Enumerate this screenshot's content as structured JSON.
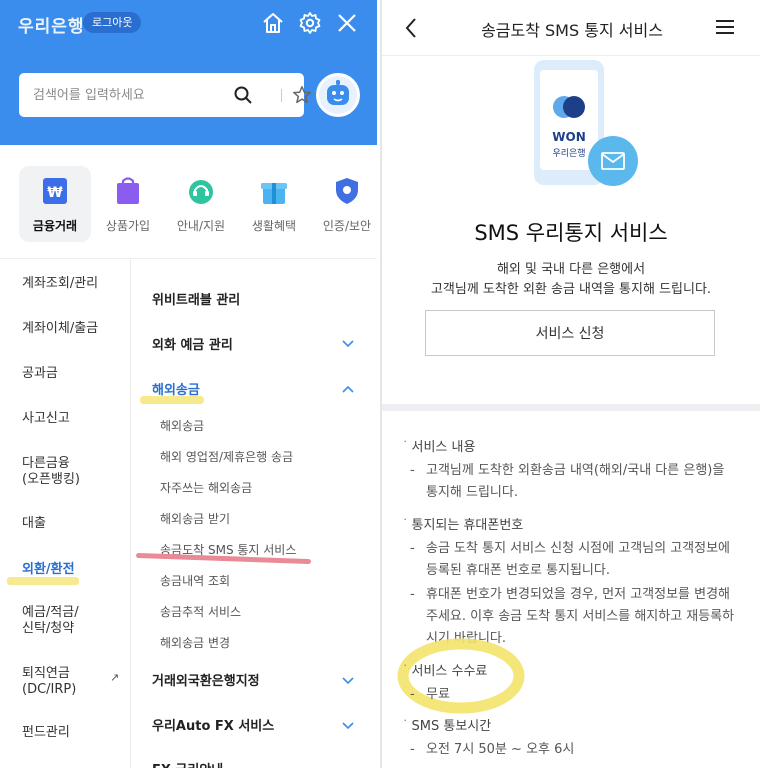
{
  "left": {
    "logo": "우리은행",
    "logout_label": "로그아웃",
    "search_placeholder": "검색어를 입력하세요",
    "categories": [
      {
        "label": "금융거래",
        "icon": "won-card-icon",
        "active": true
      },
      {
        "label": "상품가입",
        "icon": "shopping-bag-icon"
      },
      {
        "label": "안내/지원",
        "icon": "headset-icon"
      },
      {
        "label": "생활혜택",
        "icon": "gift-icon"
      },
      {
        "label": "인증/보안",
        "icon": "shield-icon"
      }
    ],
    "sidebar": [
      {
        "label": "계좌조회/관리"
      },
      {
        "label": "계좌이체/출금"
      },
      {
        "label": "공과금"
      },
      {
        "label": "사고신고"
      },
      {
        "label": "다른금융\n(오픈뱅킹)"
      },
      {
        "label": "대출"
      },
      {
        "label": "외환/환전",
        "active": true
      },
      {
        "label": "예금/적금/\n신탁/청약"
      },
      {
        "label": "퇴직연금\n(DC/IRP)",
        "external": "↗"
      },
      {
        "label": "펀드관리"
      }
    ],
    "submenu": {
      "wibee": "위비트래블 관리",
      "fx_deposit": "외화 예금 관리",
      "overseas": "해외송금",
      "overseas_items": [
        "해외송금",
        "해외 영업점/제휴은행 송금",
        "자주쓰는 해외송금",
        "해외송금 받기",
        "송금도착 SMS 통지 서비스",
        "송금내역 조회",
        "송금추적 서비스",
        "해외송금 변경"
      ],
      "designated_bank": "거래외국환은행지정",
      "autofx": "우리Auto FX 서비스",
      "fx_rate_partial": "FX 금리안내"
    },
    "highlight_color": "#f7e98d",
    "underline_color": "#e98a96"
  },
  "right": {
    "title": "송금도착 SMS 통지 서비스",
    "won_label": "WON",
    "bank_label": "우리은행",
    "heading": "SMS 우리통지 서비스",
    "desc1": "해외 및 국내 다른 은행에서",
    "desc2": "고객님께 도착한 외환 송금 내역을 통지해 드립니다.",
    "apply_label": "서비스 신청",
    "sections": [
      {
        "title": "서비스 내용",
        "items": [
          "고객님께 도착한 외환송금 내역(해외/국내 다른 은행)을 통지해 드립니다."
        ]
      },
      {
        "title": "통지되는 휴대폰번호",
        "items": [
          "송금 도착 통지 서비스 신청 시점에 고객님의 고객정보에 등록된 휴대폰 번호로 통지됩니다.",
          "휴대폰 번호가 변경되었을 경우, 먼저 고객정보를 변경해 주세요. 이후 송금 도착 통지 서비스를 해지하고 재등록하시기 바랍니다."
        ]
      },
      {
        "title": "서비스 수수료",
        "items": [
          "무료"
        ]
      },
      {
        "title": "SMS 통보시간",
        "items": [
          "오전 7시 50분 ~ 오후 6시"
        ]
      }
    ]
  }
}
